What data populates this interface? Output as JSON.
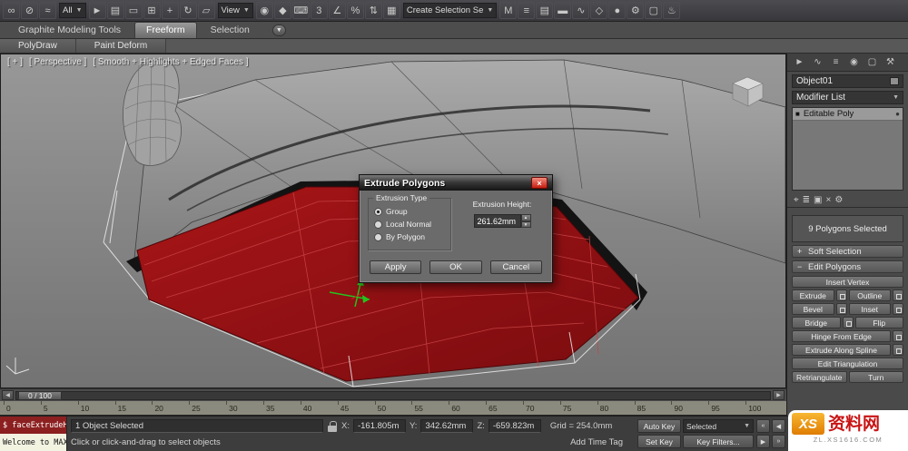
{
  "main_toolbar": {
    "selection_filter": "All",
    "reference_coordinate": "View",
    "named_selection_sets": "Create Selection Se",
    "icons_a": [
      {
        "name": "select-and-link-icon",
        "glyph": "∞"
      },
      {
        "name": "unlink-selection-icon",
        "glyph": "⊘"
      },
      {
        "name": "bind-to-spacewarp-icon",
        "glyph": "≈"
      }
    ],
    "icons_b": [
      {
        "name": "select-object-icon",
        "glyph": "►"
      },
      {
        "name": "select-by-name-icon",
        "glyph": "▤"
      },
      {
        "name": "rectangular-selection-region-icon",
        "glyph": "▭"
      },
      {
        "name": "window-crossing-icon",
        "glyph": "⊞"
      },
      {
        "name": "select-and-move-icon",
        "glyph": "+"
      },
      {
        "name": "select-and-rotate-icon",
        "glyph": "↻"
      },
      {
        "name": "select-and-uniform-scale-icon",
        "glyph": "▱"
      }
    ],
    "icons_c": [
      {
        "name": "use-pivot-point-center-icon",
        "glyph": "◉"
      },
      {
        "name": "select-and-manipulate-icon",
        "glyph": "◆"
      },
      {
        "name": "keyboard-shortcut-override-icon",
        "glyph": "⌨"
      },
      {
        "name": "snaps-toggle-icon",
        "glyph": "3"
      },
      {
        "name": "angle-snap-toggle-icon",
        "glyph": "∠"
      },
      {
        "name": "percent-snap-toggle-icon",
        "glyph": "%"
      },
      {
        "name": "spinner-snap-toggle-icon",
        "glyph": "⇅"
      },
      {
        "name": "edit-named-selection-sets-icon",
        "glyph": "▦"
      }
    ],
    "icons_d": [
      {
        "name": "mirror-icon",
        "glyph": "M"
      },
      {
        "name": "align-icon",
        "glyph": "≡"
      },
      {
        "name": "layer-manager-icon",
        "glyph": "▤"
      },
      {
        "name": "graphite-ribbon-toggle-icon",
        "glyph": "▬"
      },
      {
        "name": "curve-editor-icon",
        "glyph": "∿"
      },
      {
        "name": "schematic-view-icon",
        "glyph": "◇"
      },
      {
        "name": "material-editor-icon",
        "glyph": "●"
      },
      {
        "name": "render-setup-icon",
        "glyph": "⚙"
      },
      {
        "name": "rendered-frame-window-icon",
        "glyph": "▢"
      },
      {
        "name": "render-production-icon",
        "glyph": "♨"
      }
    ],
    "dropdown_arrow": "▼"
  },
  "ribbon": {
    "tab_graphite": "Graphite Modeling Tools",
    "tab_freeform": "Freeform",
    "tab_selection": "Selection",
    "minimize_glyph": "▼",
    "subtab_polydraw": "PolyDraw",
    "subtab_paint_deform": "Paint Deform"
  },
  "viewport": {
    "label_plus": "[ + ]",
    "label_view": "[ Perspective ]",
    "label_shading": "[ Smooth + Highlights + Edged Faces ]"
  },
  "dialog": {
    "title": "Extrude Polygons",
    "close_glyph": "×",
    "group_label": "Extrusion Type",
    "radio_group": "Group",
    "radio_local_normal": "Local Normal",
    "radio_by_polygon": "By Polygon",
    "height_label": "Extrusion Height:",
    "height_value": "261.62mm",
    "spin_up_glyph": "▲",
    "spin_down_glyph": "▼",
    "apply_label": "Apply",
    "ok_label": "OK",
    "cancel_label": "Cancel"
  },
  "command_panel": {
    "tabs": [
      {
        "name": "create-tab-icon",
        "glyph": "►"
      },
      {
        "name": "modify-tab-icon",
        "glyph": "∿"
      },
      {
        "name": "hierarchy-tab-icon",
        "glyph": "≡"
      },
      {
        "name": "motion-tab-icon",
        "glyph": "◉"
      },
      {
        "name": "display-tab-icon",
        "glyph": "▢"
      },
      {
        "name": "utilities-tab-icon",
        "glyph": "⚒"
      }
    ],
    "object_name": "Object01",
    "modifier_list": "Modifier List",
    "stack_item": "Editable Poly",
    "stack_item_icon": "■",
    "stack_tools": [
      {
        "name": "pin-stack-icon",
        "glyph": "⌖"
      },
      {
        "name": "show-end-result-icon",
        "glyph": "≣"
      },
      {
        "name": "make-unique-icon",
        "glyph": "▣"
      },
      {
        "name": "remove-modifier-icon",
        "glyph": "×"
      },
      {
        "name": "configure-modifier-sets-icon",
        "glyph": "⚙"
      }
    ],
    "selection_status": "9 Polygons Selected",
    "soft_selection_title": "Soft Selection",
    "soft_selection_state": "+",
    "edit_polygons_title": "Edit Polygons",
    "edit_polygons_state": "−",
    "buttons": {
      "insert_vertex": "Insert Vertex",
      "extrude": "Extrude",
      "outline": "Outline",
      "bevel": "Bevel",
      "inset": "Inset",
      "bridge": "Bridge",
      "flip": "Flip",
      "hinge_from_edge": "Hinge From Edge",
      "extrude_along_spline": "Extrude Along Spline",
      "edit_triangulation": "Edit Triangulation",
      "retriangulate": "Retriangulate",
      "turn": "Turn"
    }
  },
  "timeline": {
    "slider_label": "0 / 100",
    "prev_glyph": "◀",
    "next_glyph": "▶",
    "ticks": [
      "0",
      "5",
      "10",
      "15",
      "20",
      "25",
      "30",
      "35",
      "40",
      "45",
      "50",
      "55",
      "60",
      "65",
      "70",
      "75",
      "80",
      "85",
      "90",
      "95",
      "100"
    ]
  },
  "status_bar": {
    "listener_line1": "$ faceExtrudeH",
    "listener_line2": "Welcome to MAX",
    "selection_info": "1 Object Selected",
    "x_label": "X:",
    "x_value": "-161.805m",
    "y_label": "Y:",
    "y_value": "342.62mm",
    "z_label": "Z:",
    "z_value": "-659.823m",
    "grid_info": "Grid = 254.0mm",
    "prompt": "Click or click-and-drag to select objects",
    "add_time_tag": "Add Time Tag",
    "auto_key": "Auto Key",
    "set_key": "Set Key",
    "selected_set": "Selected",
    "key_filters": "Key Filters...",
    "transport": {
      "go_start_glyph": "«",
      "prev_glyph": "◀",
      "next_glyph": "▶",
      "go_end_glyph": "»"
    },
    "dropdown_arrow": "▼"
  },
  "watermark": {
    "logo": "XS",
    "site_name": "资料网",
    "url": "ZL.XS1616.COM"
  },
  "colors": {
    "selection_red": "#9d1316",
    "accent_orange": "#f7b733"
  }
}
